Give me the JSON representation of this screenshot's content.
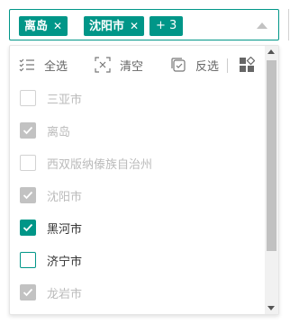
{
  "select": {
    "tags": [
      {
        "label": "离岛",
        "close": "✕"
      },
      {
        "label": "沈阳市",
        "close": "✕"
      }
    ],
    "more_label": "+ 3"
  },
  "toolbar": {
    "select_all": "全选",
    "clear": "清空",
    "invert": "反选"
  },
  "options": [
    {
      "label": "三亚市",
      "checked": false,
      "disabled": true
    },
    {
      "label": "离岛",
      "checked": true,
      "disabled": true
    },
    {
      "label": "西双版纳傣族自治州",
      "checked": false,
      "disabled": true
    },
    {
      "label": "沈阳市",
      "checked": true,
      "disabled": true
    },
    {
      "label": "黑河市",
      "checked": true,
      "disabled": false
    },
    {
      "label": "济宁市",
      "checked": false,
      "disabled": false
    },
    {
      "label": "龙岩市",
      "checked": true,
      "disabled": true
    }
  ],
  "colors": {
    "accent": "#009688",
    "disabled": "#c2c2c2"
  }
}
